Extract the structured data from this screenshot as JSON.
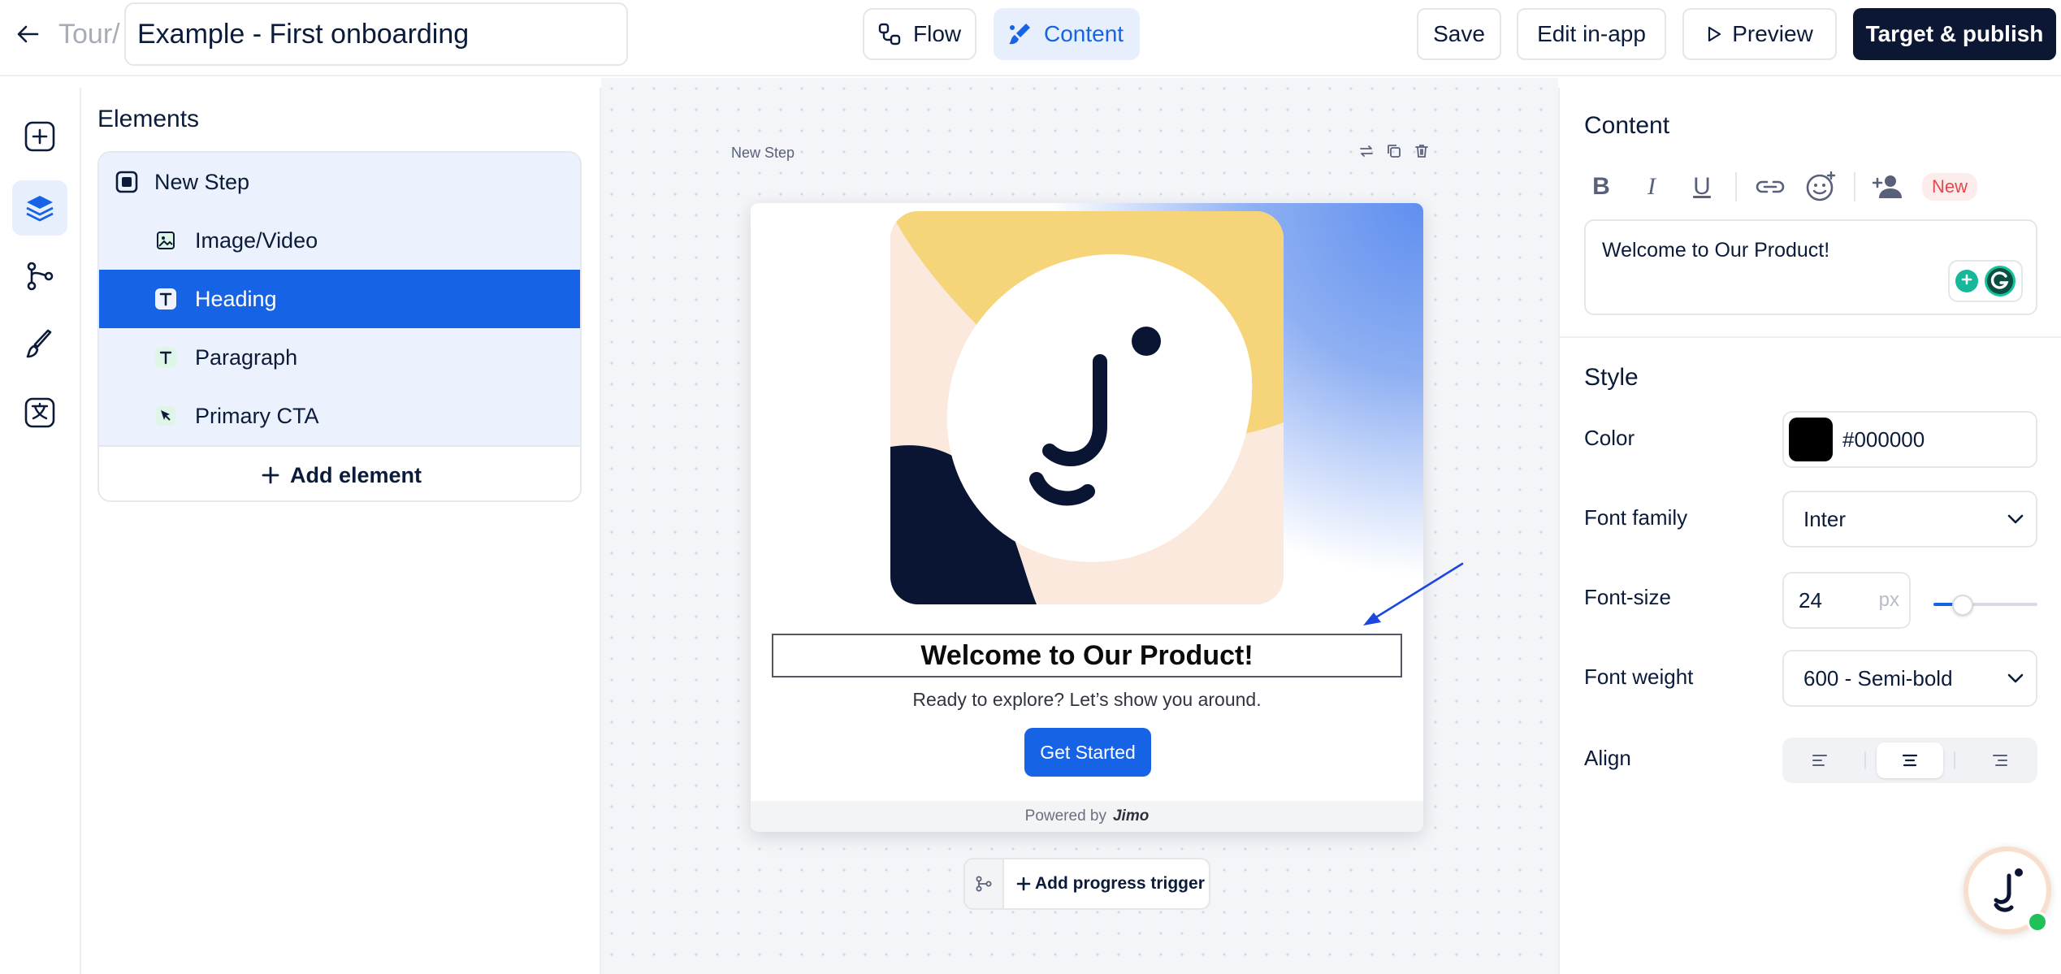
{
  "header": {
    "breadcrumb": "Tour/",
    "tour_title": "Example - First onboarding",
    "tabs": [
      {
        "label": "Flow",
        "icon": "flow-icon",
        "active": false
      },
      {
        "label": "Content",
        "icon": "brush-icon",
        "active": true
      }
    ],
    "actions": {
      "save": "Save",
      "edit_in_app": "Edit in-app",
      "preview": "Preview",
      "publish": "Target & publish"
    }
  },
  "rail": {
    "items": [
      {
        "icon": "add-square-icon",
        "active": false
      },
      {
        "icon": "layers-icon",
        "active": true
      },
      {
        "icon": "branch-icon",
        "active": false
      },
      {
        "icon": "paintbrush-icon",
        "active": false
      },
      {
        "icon": "translate-icon",
        "active": false
      }
    ]
  },
  "elements_panel": {
    "title": "Elements",
    "items": [
      {
        "label": "New Step",
        "icon": "step-icon",
        "selected": false
      },
      {
        "label": "Image/Video",
        "icon": "image-icon",
        "selected": false
      },
      {
        "label": "Heading",
        "icon": "text-icon",
        "selected": true
      },
      {
        "label": "Paragraph",
        "icon": "text-icon",
        "selected": false
      },
      {
        "label": "Primary CTA",
        "icon": "cursor-icon",
        "selected": false
      }
    ],
    "add_label": "Add element"
  },
  "canvas": {
    "step_label": "New Step",
    "heading": "Welcome to Our Product!",
    "paragraph": "Ready to explore? Let’s show you around.",
    "cta": "Get Started",
    "powered_by": "Powered by",
    "brand": "Jimo",
    "progress_trigger": "Add progress trigger"
  },
  "content_panel": {
    "title": "Content",
    "new_badge": "New",
    "text_value": "Welcome to Our Product!"
  },
  "style_panel": {
    "title": "Style",
    "color_label": "Color",
    "color_value": "#000000",
    "font_family_label": "Font family",
    "font_family_value": "Inter",
    "font_size_label": "Font-size",
    "font_size_value": "24",
    "font_size_unit": "px",
    "font_size_slider_fraction": 0.28,
    "font_weight_label": "Font weight",
    "font_weight_value": "600 - Semi-bold",
    "align_label": "Align",
    "align_selected": "center"
  },
  "colors": {
    "accent": "#1763e5",
    "publish_bg": "#0b1733",
    "new_badge": "#e5484d",
    "online": "#21c15a"
  }
}
